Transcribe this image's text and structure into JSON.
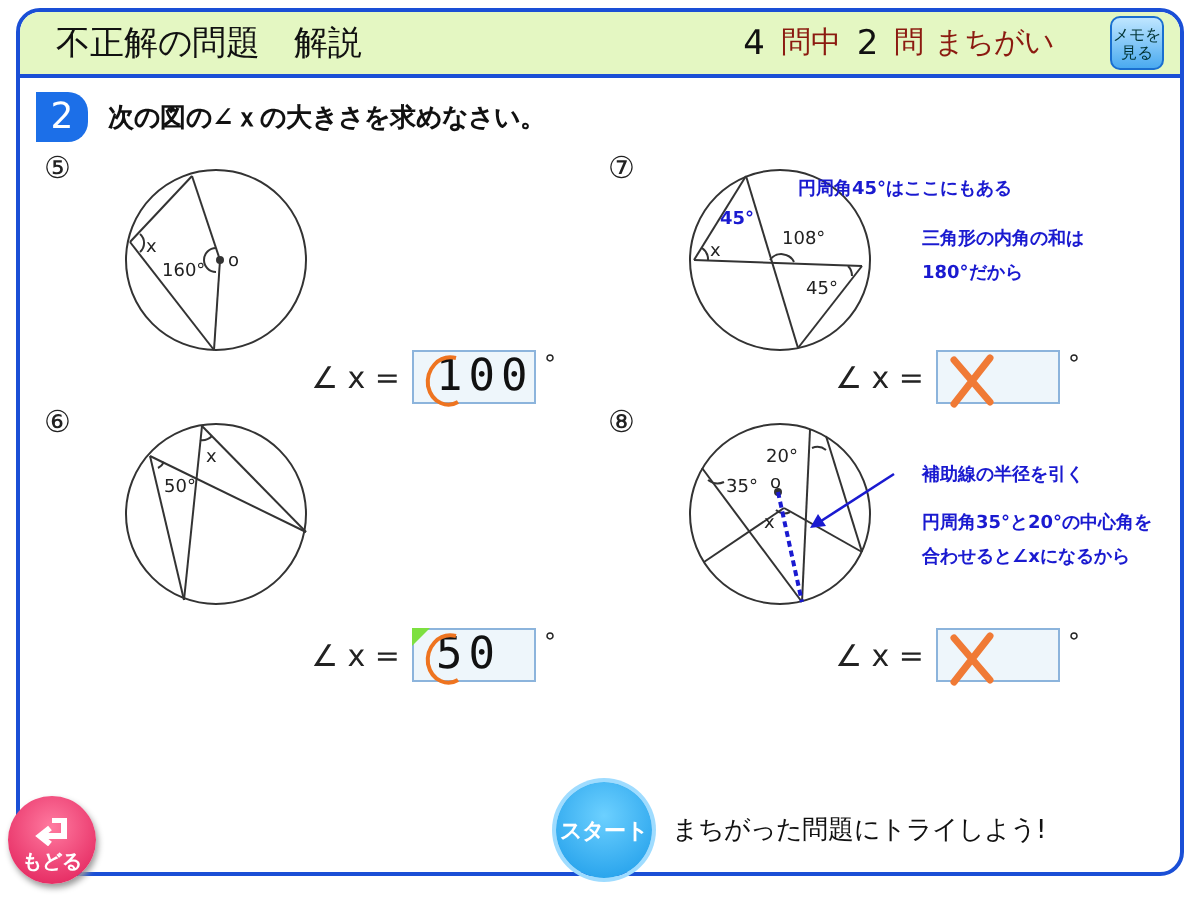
{
  "header": {
    "title": "不正解の問題　解説",
    "total": "4",
    "total_unit": "問中",
    "wrong": "2",
    "wrong_unit": "問 まちがい",
    "memo_button": [
      "メモを",
      "見る"
    ]
  },
  "question": {
    "number": "2",
    "text": "次の図の∠ｘの大きさを求めなさい。"
  },
  "problems": [
    {
      "label": "⑤",
      "diagram_labels": [
        "x",
        "160°",
        "o"
      ],
      "answer_label": "∠ x =",
      "value": "100",
      "unit": "°",
      "correct": true,
      "flag": false
    },
    {
      "label": "⑦",
      "diagram_labels": [
        "45°",
        "x",
        "108°",
        "45°"
      ],
      "notes": [
        {
          "lines": [
            "円周角45°はここにもある"
          ]
        },
        {
          "lines": [
            "三角形の内角の和は",
            "180°だから"
          ]
        }
      ],
      "answer_label": "∠ x =",
      "unit": "°",
      "correct": false,
      "flag": false
    },
    {
      "label": "⑥",
      "diagram_labels": [
        "50°",
        "x"
      ],
      "answer_label": "∠ x =",
      "value": "50",
      "unit": "°",
      "correct": true,
      "flag": true
    },
    {
      "label": "⑧",
      "diagram_labels": [
        "35°",
        "20°",
        "o",
        "x"
      ],
      "notes": [
        {
          "lines": [
            "補助線の半径を引く"
          ]
        },
        {
          "lines": [
            "円周角35°と20°の中心角を",
            "合わせると∠xになるから"
          ]
        }
      ],
      "answer_label": "∠ x =",
      "unit": "°",
      "correct": false,
      "flag": false
    }
  ],
  "footer": {
    "back_button": "もどる",
    "start_button": "スタート",
    "prompt": "まちがった問題にトライしよう!"
  }
}
